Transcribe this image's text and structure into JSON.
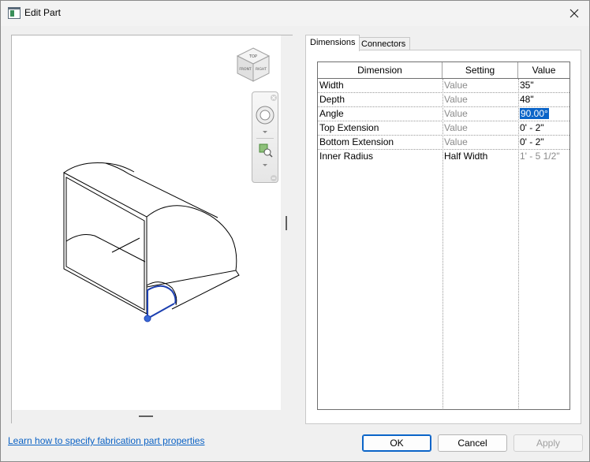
{
  "window": {
    "title": "Edit Part"
  },
  "viewcube": {
    "top_label": "TOP",
    "front_label": "FRONT",
    "right_label": "RIGHT"
  },
  "tabs": [
    {
      "label": "Dimensions",
      "active": true
    },
    {
      "label": "Connectors",
      "active": false
    }
  ],
  "grid": {
    "columns": [
      "Dimension",
      "Setting",
      "Value"
    ],
    "rows": [
      {
        "dimension": "Width",
        "setting": "Value",
        "value": "35\""
      },
      {
        "dimension": "Depth",
        "setting": "Value",
        "value": "48\""
      },
      {
        "dimension": "Angle",
        "setting": "Value",
        "value": "90.00°"
      },
      {
        "dimension": "Top Extension",
        "setting": "Value",
        "value": "0' - 2\""
      },
      {
        "dimension": "Bottom Extension",
        "setting": "Value",
        "value": "0' - 2\""
      },
      {
        "dimension": "Inner Radius",
        "setting": "Half Width",
        "value": "1' - 5 1/2\""
      }
    ]
  },
  "footer": {
    "help_link": "Learn how to specify fabrication part properties",
    "ok": "OK",
    "cancel": "Cancel",
    "apply": "Apply"
  },
  "colors": {
    "accent": "#0a64c8",
    "link": "#0b62c4",
    "highlight": "#0a64c8"
  }
}
